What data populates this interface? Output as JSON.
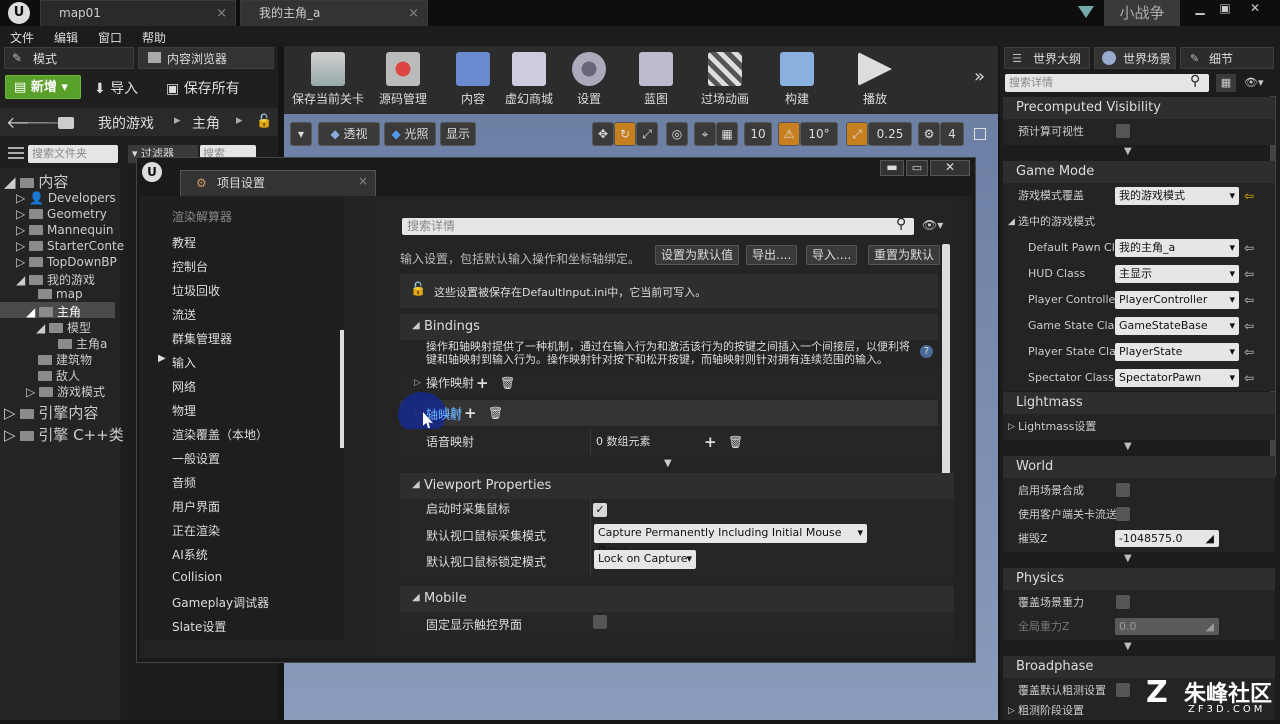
{
  "title_tabs": [
    "map01",
    "我的主角_a"
  ],
  "window_user": "小战争",
  "menubar": [
    "文件",
    "编辑",
    "窗口",
    "帮助"
  ],
  "left": {
    "tabs": [
      "模式",
      "内容浏览器"
    ],
    "new_btn": "新增",
    "import_btn": "导入",
    "save_all_btn": "保存所有",
    "breadcrumb": [
      "我的游戏",
      "主角"
    ],
    "filter_placeholder": "搜索文件夹",
    "filter_btn": "过滤器",
    "search_placeholder": "搜索",
    "tree": [
      "内容",
      "Developers",
      "Geometry",
      "Mannequin",
      "StarterConte",
      "TopDownBP",
      "我的游戏",
      "map",
      "主角",
      "模型",
      "主角a",
      "建筑物",
      "敌人",
      "游戏模式",
      "引擎内容",
      "引擎 C++类"
    ]
  },
  "toolbar": [
    "保存当前关卡",
    "源码管理",
    "内容",
    "虚幻商城",
    "设置",
    "蓝图",
    "过场动画",
    "构建",
    "播放"
  ],
  "viewport": {
    "perspective": "透视",
    "lit": "光照",
    "show": "显示",
    "grid_size": "10",
    "rotation_snap": "10°",
    "scale_snap": "0.25",
    "camera_speed": "4"
  },
  "dialog": {
    "tab": "项目设置",
    "search_placeholder": "搜索详情",
    "categories": [
      "渲染解算器",
      "教程",
      "控制台",
      "垃圾回收",
      "流送",
      "群集管理器",
      "输入",
      "网络",
      "物理",
      "渲染覆盖（本地）",
      "一般设置",
      "音频",
      "用户界面",
      "正在渲染",
      "AI系统",
      "Collision",
      "Gameplay调试器",
      "Slate设置"
    ],
    "description": "输入设置，包括默认输入操作和坐标轴绑定。",
    "buttons": [
      "设置为默认值",
      "导出....",
      "导入....",
      "重置为默认"
    ],
    "notice": "这些设置被保存在DefaultInput.ini中，它当前可写入。",
    "bindings": {
      "header": "Bindings",
      "help": "操作和轴映射提供了一种机制，通过在输入行为和激活该行为的按键之间插入一个间接层，以便利将键和轴映射到输入行为。操作映射针对按下和松开按键，而轴映射则针对拥有连续范围的输入。",
      "action_mappings": "操作映射",
      "axis_mappings": "轴映射",
      "speech_mappings": "语音映射",
      "speech_value": "0 数组元素"
    },
    "viewport_props": {
      "header": "Viewport Properties",
      "capture_mouse_label": "启动时采集鼠标",
      "capture_mode_label": "默认视口鼠标采集模式",
      "capture_mode_value": "Capture Permanently Including Initial Mouse Down",
      "lock_mode_label": "默认视口鼠标锁定模式",
      "lock_mode_value": "Lock on Capture"
    },
    "mobile": {
      "header": "Mobile",
      "always_show_touch": "固定显示触控界面"
    }
  },
  "right": {
    "tabs": [
      "世界大纲",
      "世界场景",
      "细节"
    ],
    "search_placeholder": "搜索详情",
    "precomputed": {
      "header": "Precomputed Visibility",
      "label": "预计算可视性"
    },
    "game_mode": {
      "header": "Game Mode",
      "override_label": "游戏模式覆盖",
      "override_value": "我的游戏模式",
      "selected_label": "选中的游戏模式",
      "rows": [
        {
          "label": "Default Pawn Cla",
          "value": "我的主角_a"
        },
        {
          "label": "HUD Class",
          "value": "主显示"
        },
        {
          "label": "Player Controlle",
          "value": "PlayerController"
        },
        {
          "label": "Game State Clas",
          "value": "GameStateBase"
        },
        {
          "label": "Player State Cla",
          "value": "PlayerState"
        },
        {
          "label": "Spectator Class",
          "value": "SpectatorPawn"
        }
      ]
    },
    "lightmass": {
      "header": "Lightmass",
      "label": "Lightmass设置"
    },
    "world": {
      "header": "World",
      "rows": [
        "启用场景合成",
        "使用客户端关卡流送",
        "摧毁Z"
      ],
      "kill_z": "-1048575.0"
    },
    "physics": {
      "header": "Physics",
      "rows": [
        "覆盖场景重力",
        "全局重力Z"
      ],
      "gravity": "0.0"
    },
    "broadphase": {
      "header": "Broadphase",
      "rows": [
        "覆盖默认粗测设置",
        "粗测阶段设置"
      ]
    }
  },
  "watermark": {
    "name": "朱峰社区",
    "url": "ZF3D.COM"
  }
}
